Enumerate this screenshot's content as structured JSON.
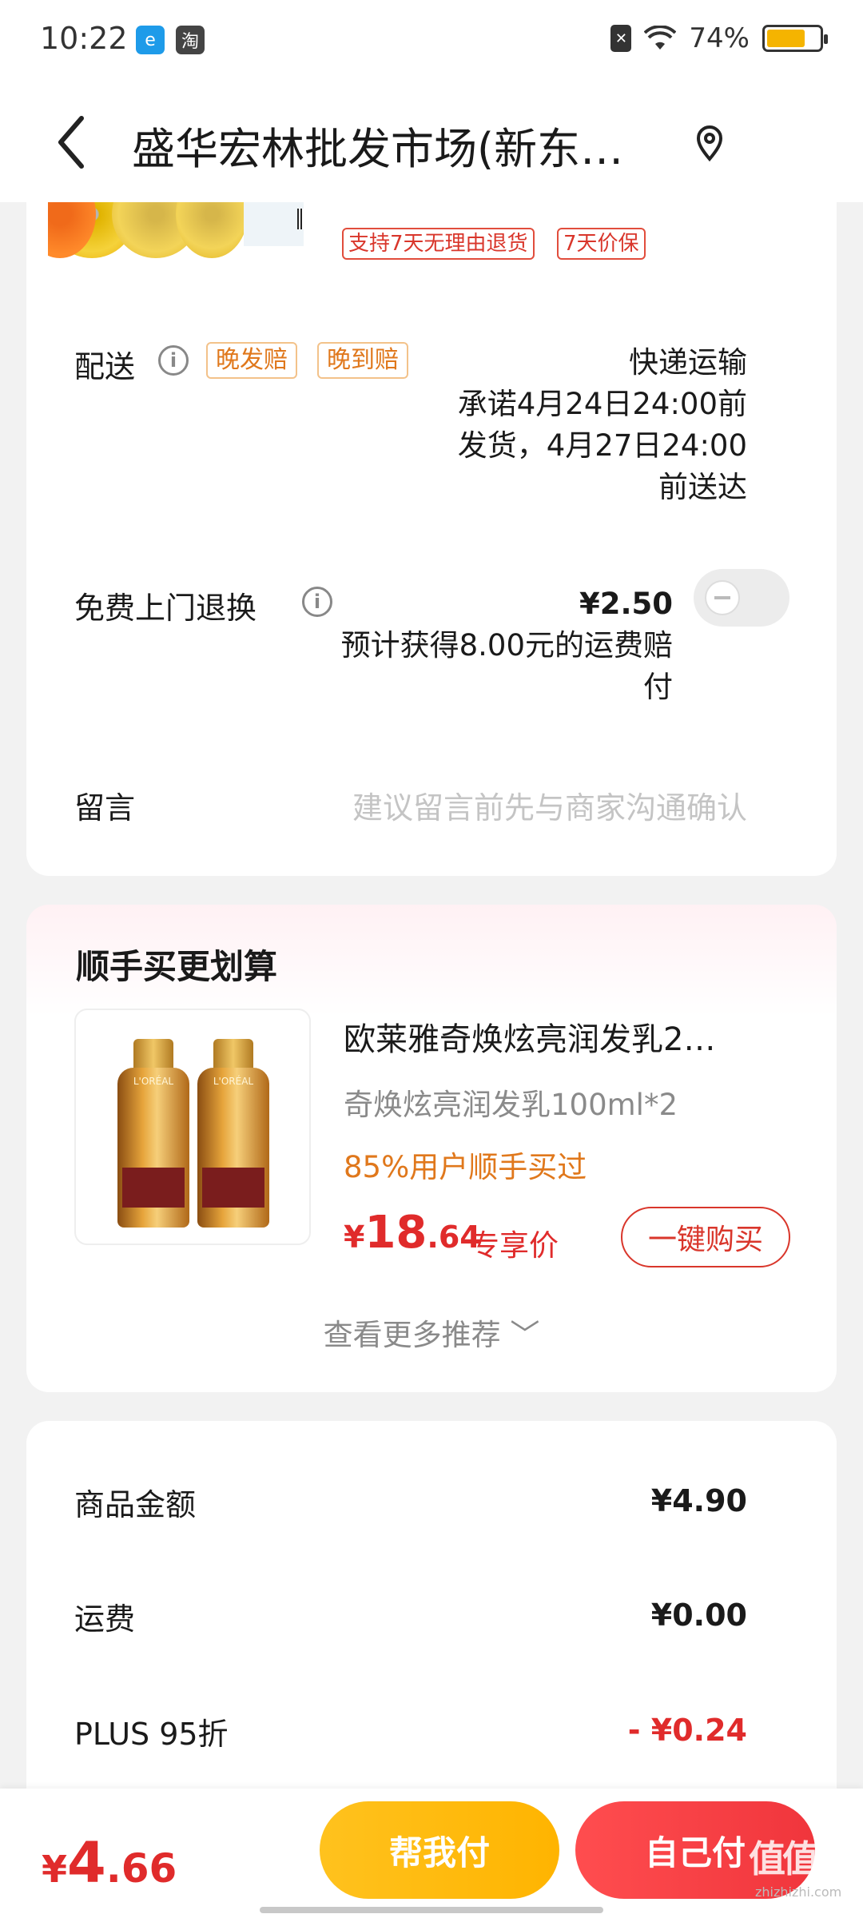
{
  "status_bar": {
    "time": "10:22",
    "app_icon_1": "e",
    "app_icon_2": "淘",
    "battery": "74%",
    "battery_level": 0.74
  },
  "header": {
    "title": "盛华宏林批发市场(新东…"
  },
  "product": {
    "tags": [
      "支持7天无理由退货",
      "7天价保"
    ]
  },
  "delivery": {
    "label": "配送",
    "tags": [
      "晚发赔",
      "晚到赔"
    ],
    "method": "快递运输",
    "promise_line1": "承诺4月24日24:00前",
    "promise_line2": "发货，4月27日24:00",
    "promise_line3": "前送达"
  },
  "return_service": {
    "label": "免费上门退换",
    "price": "¥2.50",
    "note_line1": "预计获得8.00元的运费赔",
    "note_line2": "付",
    "enabled": false
  },
  "message": {
    "label": "留言",
    "placeholder": "建议留言前先与商家沟通确认"
  },
  "recommend": {
    "title": "顺手买更划算",
    "image_text": "L'ORÉAL",
    "item_name": "欧莱雅奇焕炫亮润发乳2…",
    "item_spec": "奇焕炫亮润发乳100ml*2",
    "item_bought": "85%用户顺手买过",
    "price_symbol": "¥",
    "price_int": "18",
    "price_dec": ".64",
    "price_label": "专享价",
    "buy_button": "一键购买",
    "more_link": "查看更多推荐 ﹀"
  },
  "summary": {
    "rows": [
      {
        "label": "商品金额",
        "value": "¥4.90"
      },
      {
        "label": "运费",
        "value": "¥0.00"
      },
      {
        "label": "PLUS 95折",
        "value": "- ¥0.24"
      }
    ]
  },
  "bottom_bar": {
    "total_symbol": "¥",
    "total_int": "4",
    "total_dec": ".66",
    "pay_friend": "帮我付",
    "pay_self": "自己付",
    "watermark": "值值值",
    "watermark_sub": "zhizhizhi.com"
  },
  "colors": {
    "accent_red": "#e02b2b",
    "accent_orange": "#e0781c",
    "accent_yellow": "#ffb400"
  }
}
